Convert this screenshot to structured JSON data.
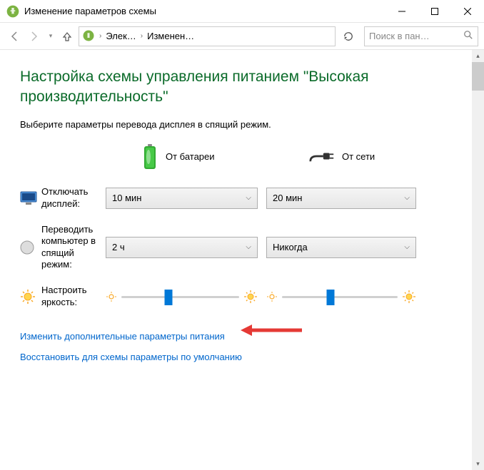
{
  "window": {
    "title": "Изменение параметров схемы"
  },
  "breadcrumb": {
    "item1": "Элек…",
    "item2": "Изменен…"
  },
  "search": {
    "placeholder": "Поиск в пан…"
  },
  "heading": "Настройка схемы управления питанием \"Высокая производительность\"",
  "subheading": "Выберите параметры перевода дисплея в спящий режим.",
  "columns": {
    "battery": "От батареи",
    "ac": "От сети"
  },
  "rows": {
    "display_off": {
      "label": "Отключать дисплей:",
      "battery": "10 мин",
      "ac": "20 мин"
    },
    "sleep": {
      "label": "Переводить компьютер в спящий режим:",
      "battery": "2 ч",
      "ac": "Никогда"
    },
    "brightness": {
      "label": "Настроить яркость:",
      "battery_pct": 40,
      "ac_pct": 42
    }
  },
  "links": {
    "advanced": "Изменить дополнительные параметры питания",
    "restore": "Восстановить для схемы параметры по умолчанию"
  },
  "colors": {
    "heading": "#0b6b2a",
    "link": "#0066cc",
    "accent": "#0078d7"
  }
}
